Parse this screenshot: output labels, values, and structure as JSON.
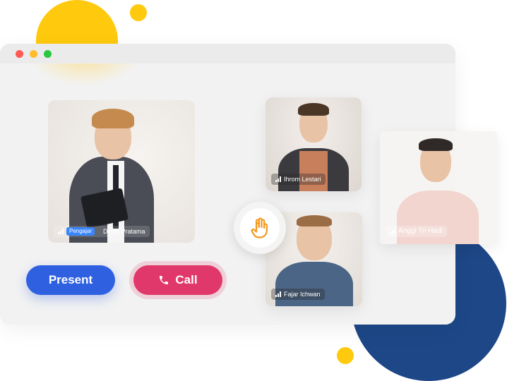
{
  "window": {
    "controls": [
      "close",
      "minimize",
      "maximize"
    ]
  },
  "participants": [
    {
      "name": "Devin Pratama",
      "role_tag": "Pengajar"
    },
    {
      "name": "Ihrom Lestari"
    },
    {
      "name": "Fajar Ichwan"
    },
    {
      "name": "Anggi Tri Hadi"
    }
  ],
  "controls": {
    "present_label": "Present",
    "call_label": "Call",
    "raise_hand_icon": "hand-icon",
    "call_icon": "phone-icon"
  },
  "colors": {
    "present": "#2f60e0",
    "call": "#e0386a",
    "accent_yellow": "#ffc90d",
    "accent_blue": "#1d4787",
    "tag_blue": "#3a86ff"
  }
}
